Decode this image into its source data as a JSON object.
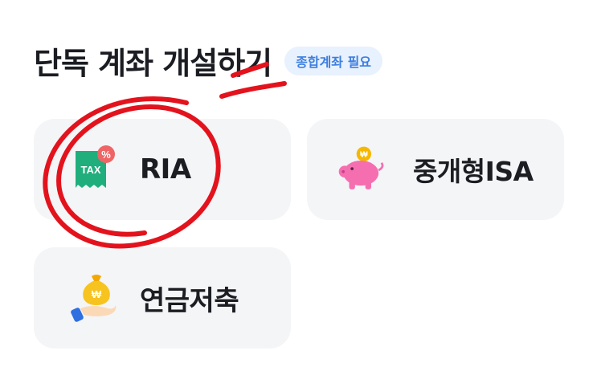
{
  "header": {
    "title": "단독 계좌 개설하기",
    "badge": "종합계좌 필요"
  },
  "cards": [
    {
      "label": "RIA",
      "icon": "tax-receipt-icon"
    },
    {
      "label": "중개형ISA",
      "icon": "piggy-bank-icon"
    },
    {
      "label": "연금저축",
      "icon": "money-bag-hand-icon"
    }
  ],
  "icon_texts": {
    "tax": "TAX",
    "percent": "%",
    "won": "₩"
  },
  "colors": {
    "badge_bg": "#e8f1fe",
    "badge_text": "#3d7fe0",
    "card_bg": "#f4f5f7",
    "annotation_red": "#e3131d"
  }
}
